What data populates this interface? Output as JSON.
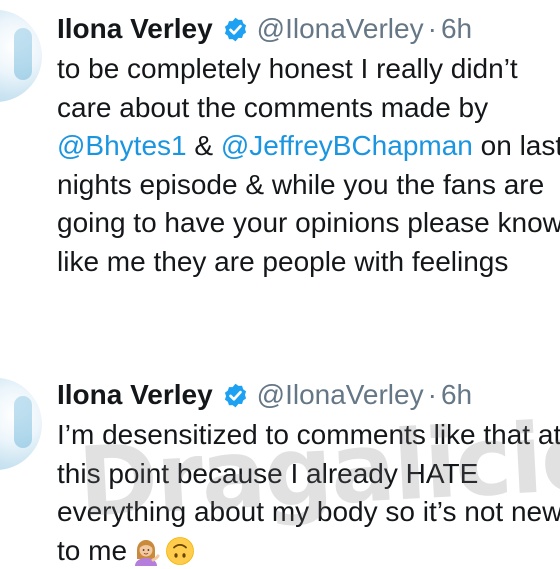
{
  "tweets": [
    {
      "display_name": "Ilona Verley",
      "handle": "@IlonaVerley",
      "separator": "·",
      "time": "6h",
      "lines": {
        "l1": "to be completely honest I really didn’t",
        "l2": "care about the comments made by",
        "l3_mention1": "@Bhytes1",
        "l3_mid": " & ",
        "l3_mention2": "@JeffreyBChapman",
        "l3_end": " on last",
        "l4": "nights episode & while you the fans are",
        "l5": "going to have your opinions please know",
        "l6": "like me they are people with feelings"
      }
    },
    {
      "display_name": "Ilona Verley",
      "handle": "@IlonaVerley",
      "separator": "·",
      "time": "6h",
      "lines": {
        "l1": "I’m desensitized to comments like that at",
        "l2": "this point because I already HATE",
        "l3": "everything about my body so it’s not new",
        "l4": "to me"
      },
      "emojis": [
        "woman-tipping-hand-icon",
        "upside-down-face-icon"
      ]
    }
  ],
  "watermark": "Dragalicious",
  "colors": {
    "mention": "#1b95e0",
    "verified": "#1da1f2",
    "secondary_text": "#657786",
    "primary_text": "#14171a"
  }
}
